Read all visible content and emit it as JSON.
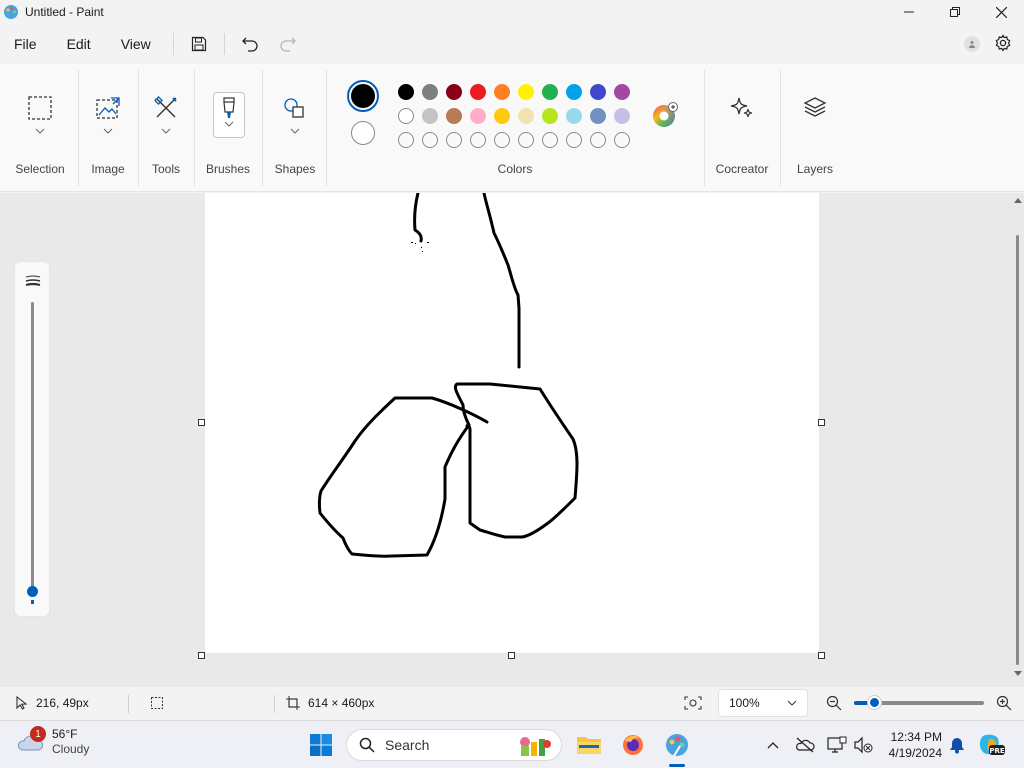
{
  "window": {
    "title": "Untitled - Paint"
  },
  "menu": {
    "file": "File",
    "edit": "Edit",
    "view": "View"
  },
  "ribbon": {
    "groups": {
      "selection": "Selection",
      "image": "Image",
      "tools": "Tools",
      "brushes": "Brushes",
      "shapes": "Shapes",
      "colors": "Colors",
      "cocreator": "Cocreator",
      "layers": "Layers"
    },
    "primary_color": "#000000",
    "secondary_color": "#ffffff",
    "palette_row1": [
      "#000000",
      "#7f7f7f",
      "#880015",
      "#ed1c24",
      "#ff7f27",
      "#fff200",
      "#22b14c",
      "#00a2e8",
      "#3f48cc",
      "#a349a4"
    ],
    "palette_row2": [
      "#ffffff",
      "#c3c3c3",
      "#b97a57",
      "#ffaec9",
      "#ffc90e",
      "#efe4b0",
      "#b5e61d",
      "#99d9ea",
      "#7092be",
      "#c8bfe7"
    ],
    "palette_row3_empty_count": 10
  },
  "status": {
    "cursor_position": "216, 49px",
    "canvas_size": "614 × 460px",
    "zoom": "100%",
    "zoom_level": 0.15
  },
  "taskbar": {
    "weather_temp": "56°F",
    "weather_desc": "Cloudy",
    "weather_badge": "1",
    "search_label": "Search",
    "time": "12:34 PM",
    "date": "4/19/2024"
  },
  "colors": {
    "accent": "#005fb8"
  }
}
